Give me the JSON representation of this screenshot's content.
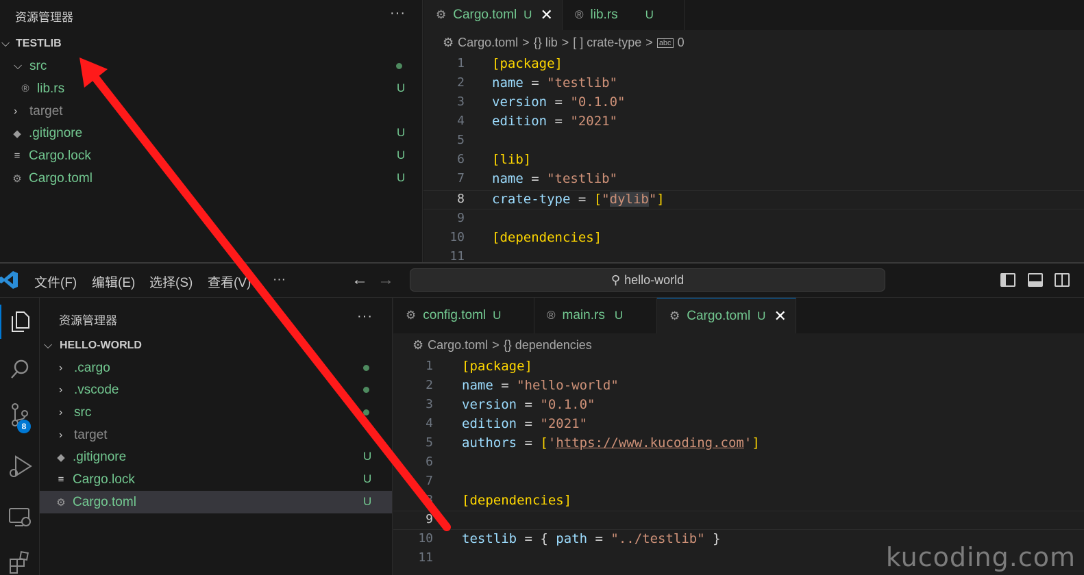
{
  "top": {
    "explorer": {
      "title": "资源管理器",
      "more": "···",
      "root": "TESTLIB",
      "items": [
        {
          "label": "src",
          "kind": "folder-open",
          "badge": "dot"
        },
        {
          "label": "lib.rs",
          "kind": "rust",
          "badge": "U"
        },
        {
          "label": "target",
          "kind": "folder",
          "badge": ""
        },
        {
          "label": ".gitignore",
          "kind": "git",
          "badge": "U"
        },
        {
          "label": "Cargo.lock",
          "kind": "lines",
          "badge": "U"
        },
        {
          "label": "Cargo.toml",
          "kind": "gear",
          "badge": "U"
        }
      ]
    },
    "tabs": [
      {
        "label": "Cargo.toml",
        "badge": "U",
        "close": "✕",
        "active": true
      },
      {
        "label": "lib.rs",
        "badge": "U",
        "close": "",
        "active": false
      }
    ],
    "breadcrumb": {
      "file": "Cargo.toml",
      "sep": ">",
      "b1": "{} lib",
      "b2": "[ ] crate-type",
      "b3": "0"
    },
    "code": [
      {
        "n": "1",
        "text": "[package]"
      },
      {
        "n": "2",
        "text": "name = \"testlib\""
      },
      {
        "n": "3",
        "text": "version = \"0.1.0\""
      },
      {
        "n": "4",
        "text": "edition = \"2021\""
      },
      {
        "n": "5",
        "text": ""
      },
      {
        "n": "6",
        "text": "[lib]"
      },
      {
        "n": "7",
        "text": "name = \"testlib\""
      },
      {
        "n": "8",
        "text": "crate-type = [\"dylib\"]"
      },
      {
        "n": "9",
        "text": ""
      },
      {
        "n": "10",
        "text": "[dependencies]"
      },
      {
        "n": "11",
        "text": ""
      }
    ],
    "code_parts": {
      "l1": "[package]",
      "l2k": "name",
      "l2s": "\"testlib\"",
      "l3k": "version",
      "l3s": "\"0.1.0\"",
      "l4k": "edition",
      "l4s": "\"2021\"",
      "l6": "[lib]",
      "l7k": "name",
      "l7s": "\"testlib\"",
      "l8k": "crate-type",
      "l8q1": "\"",
      "l8v": "dylib",
      "l8q2": "\"",
      "l10": "[dependencies]",
      "eq": " = "
    }
  },
  "bottom": {
    "menus": [
      "文件(F)",
      "编辑(E)",
      "选择(S)",
      "查看(V)",
      "···"
    ],
    "nav_back": "←",
    "nav_forward": "→",
    "search_text": "hello-world",
    "activity": {
      "scm_badge": "8"
    },
    "explorer": {
      "title": "资源管理器",
      "more": "···",
      "root": "HELLO-WORLD",
      "items": [
        {
          "label": ".cargo",
          "kind": "folder",
          "badge": "dot"
        },
        {
          "label": ".vscode",
          "kind": "folder",
          "badge": "dot"
        },
        {
          "label": "src",
          "kind": "folder",
          "badge": "dot"
        },
        {
          "label": "target",
          "kind": "folder",
          "badge": ""
        },
        {
          "label": ".gitignore",
          "kind": "git",
          "badge": "U"
        },
        {
          "label": "Cargo.lock",
          "kind": "lines",
          "badge": "U"
        },
        {
          "label": "Cargo.toml",
          "kind": "gear",
          "badge": "U"
        }
      ]
    },
    "tabs": [
      {
        "label": "config.toml",
        "badge": "U"
      },
      {
        "label": "main.rs",
        "badge": "U"
      },
      {
        "label": "Cargo.toml",
        "badge": "U",
        "close": "✕"
      }
    ],
    "breadcrumb": {
      "file": "Cargo.toml",
      "sep": ">",
      "b1": "{} dependencies"
    },
    "code_parts": {
      "l1": "[package]",
      "l2k": "name",
      "l2s": "\"hello-world\"",
      "l3k": "version",
      "l3s": "\"0.1.0\"",
      "l4k": "edition",
      "l4s": "\"2021\"",
      "l5k": "authors",
      "l5b1": "[",
      "l5q1": "'",
      "l5url": "https://www.kucoding.com",
      "l5q2": "'",
      "l5b2": "]",
      "l8": "[dependencies]",
      "l10k": "testlib",
      "l10o": "{ ",
      "l10k2": "path",
      "l10s": "\"../testlib\"",
      "l10c": " }",
      "eq": " = "
    },
    "line_numbers": [
      "1",
      "2",
      "3",
      "4",
      "5",
      "6",
      "7",
      "8",
      "9",
      "10",
      "11"
    ]
  },
  "watermark": "kucoding.com",
  "colors": {
    "accent": "#0078d4",
    "git_untracked": "#73c991",
    "arrow": "#ff1a1a"
  }
}
